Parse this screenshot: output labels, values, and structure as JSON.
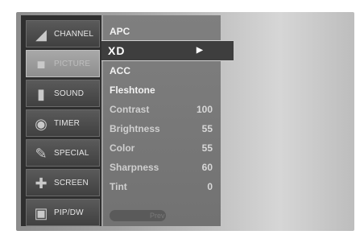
{
  "sidebar": {
    "items": [
      {
        "label": "CHANNEL",
        "icon": "satellite-dish-icon"
      },
      {
        "label": "PICTURE",
        "icon": "picture-icon",
        "active": true
      },
      {
        "label": "SOUND",
        "icon": "speaker-icon"
      },
      {
        "label": "TIMER",
        "icon": "clock-icon"
      },
      {
        "label": "SPECIAL",
        "icon": "wrench-icon"
      },
      {
        "label": "SCREEN",
        "icon": "move-arrows-icon"
      },
      {
        "label": "PIP/DW",
        "icon": "pip-icon"
      }
    ]
  },
  "menu": {
    "items": [
      {
        "label": "APC",
        "value": ""
      },
      {
        "label": "XD",
        "value": "▶",
        "selected": true
      },
      {
        "label": "ACC",
        "value": ""
      },
      {
        "label": "Fleshtone",
        "value": ""
      },
      {
        "label": "Contrast",
        "value": "100"
      },
      {
        "label": "Brightness",
        "value": "55"
      },
      {
        "label": "Color",
        "value": "55"
      },
      {
        "label": "Sharpness",
        "value": "60"
      },
      {
        "label": "Tint",
        "value": "0"
      }
    ],
    "prev_label": "Prev"
  }
}
